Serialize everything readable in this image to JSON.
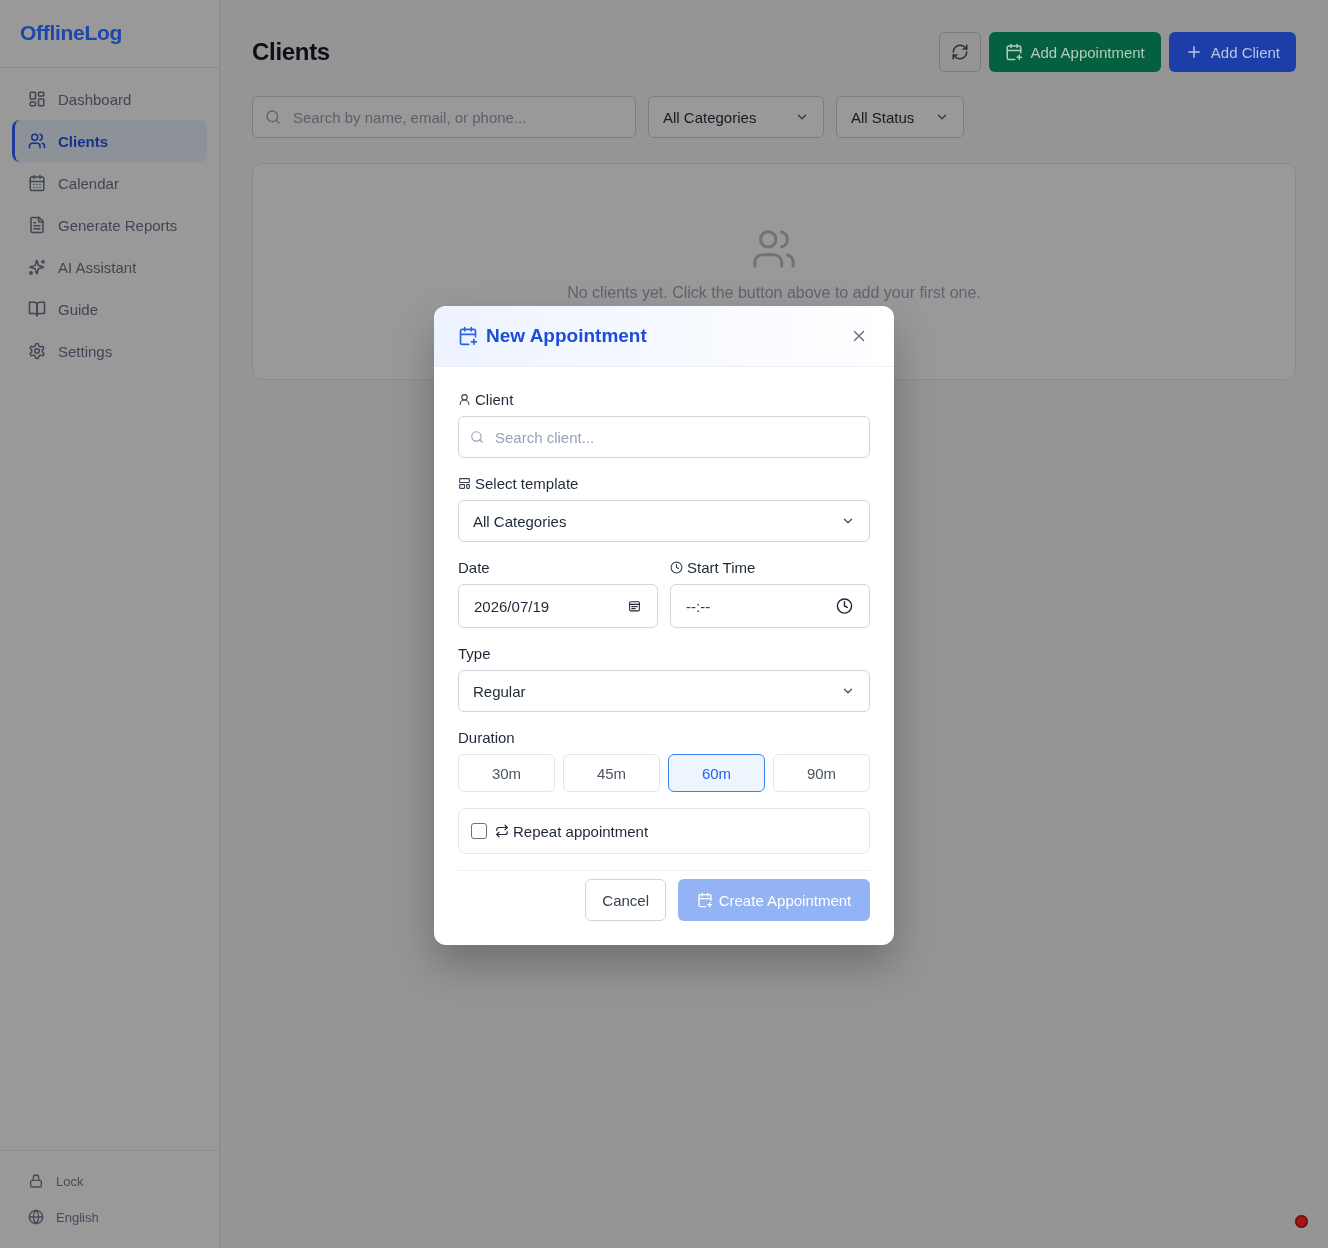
{
  "app": {
    "name": "OfflineLog"
  },
  "sidebar": {
    "items": [
      {
        "label": "Dashboard",
        "selected": false
      },
      {
        "label": "Clients",
        "selected": true
      },
      {
        "label": "Calendar",
        "selected": false
      },
      {
        "label": "Generate Reports",
        "selected": false
      },
      {
        "label": "AI Assistant",
        "selected": false
      },
      {
        "label": "Guide",
        "selected": false
      },
      {
        "label": "Settings",
        "selected": false
      }
    ],
    "footer": [
      {
        "label": "Lock"
      },
      {
        "label": "English"
      }
    ]
  },
  "header": {
    "title": "Clients",
    "actions": [
      {
        "label": "Add Appointment",
        "kind": "success"
      },
      {
        "label": "Add Client",
        "kind": "primary"
      }
    ]
  },
  "filters": {
    "search": {
      "placeholder": "Search by name, email, or phone..."
    },
    "selects": [
      {
        "value": "All Categories"
      },
      {
        "value": "All Status"
      }
    ]
  },
  "empty_state": {
    "message": "No clients yet. Click the button above to add your first one."
  },
  "modal": {
    "title": "New Appointment",
    "client": {
      "label": "Client",
      "placeholder": "Search client..."
    },
    "template": {
      "label": "Select template",
      "value": "All Categories"
    },
    "date": {
      "label": "Date",
      "value": "2026/07/19"
    },
    "start_time": {
      "label": "Start Time",
      "placeholder": "--:--"
    },
    "type": {
      "label": "Type",
      "value": "Regular"
    },
    "duration": {
      "label": "Duration",
      "options": [
        {
          "label": "30m",
          "selected": false
        },
        {
          "label": "45m",
          "selected": false
        },
        {
          "label": "60m",
          "selected": true
        },
        {
          "label": "90m",
          "selected": false
        }
      ]
    },
    "repeat": {
      "label": "Repeat appointment",
      "checked": false
    },
    "cancel": {
      "label": "Cancel"
    },
    "create": {
      "label": "Create Appointment",
      "disabled": true
    }
  }
}
